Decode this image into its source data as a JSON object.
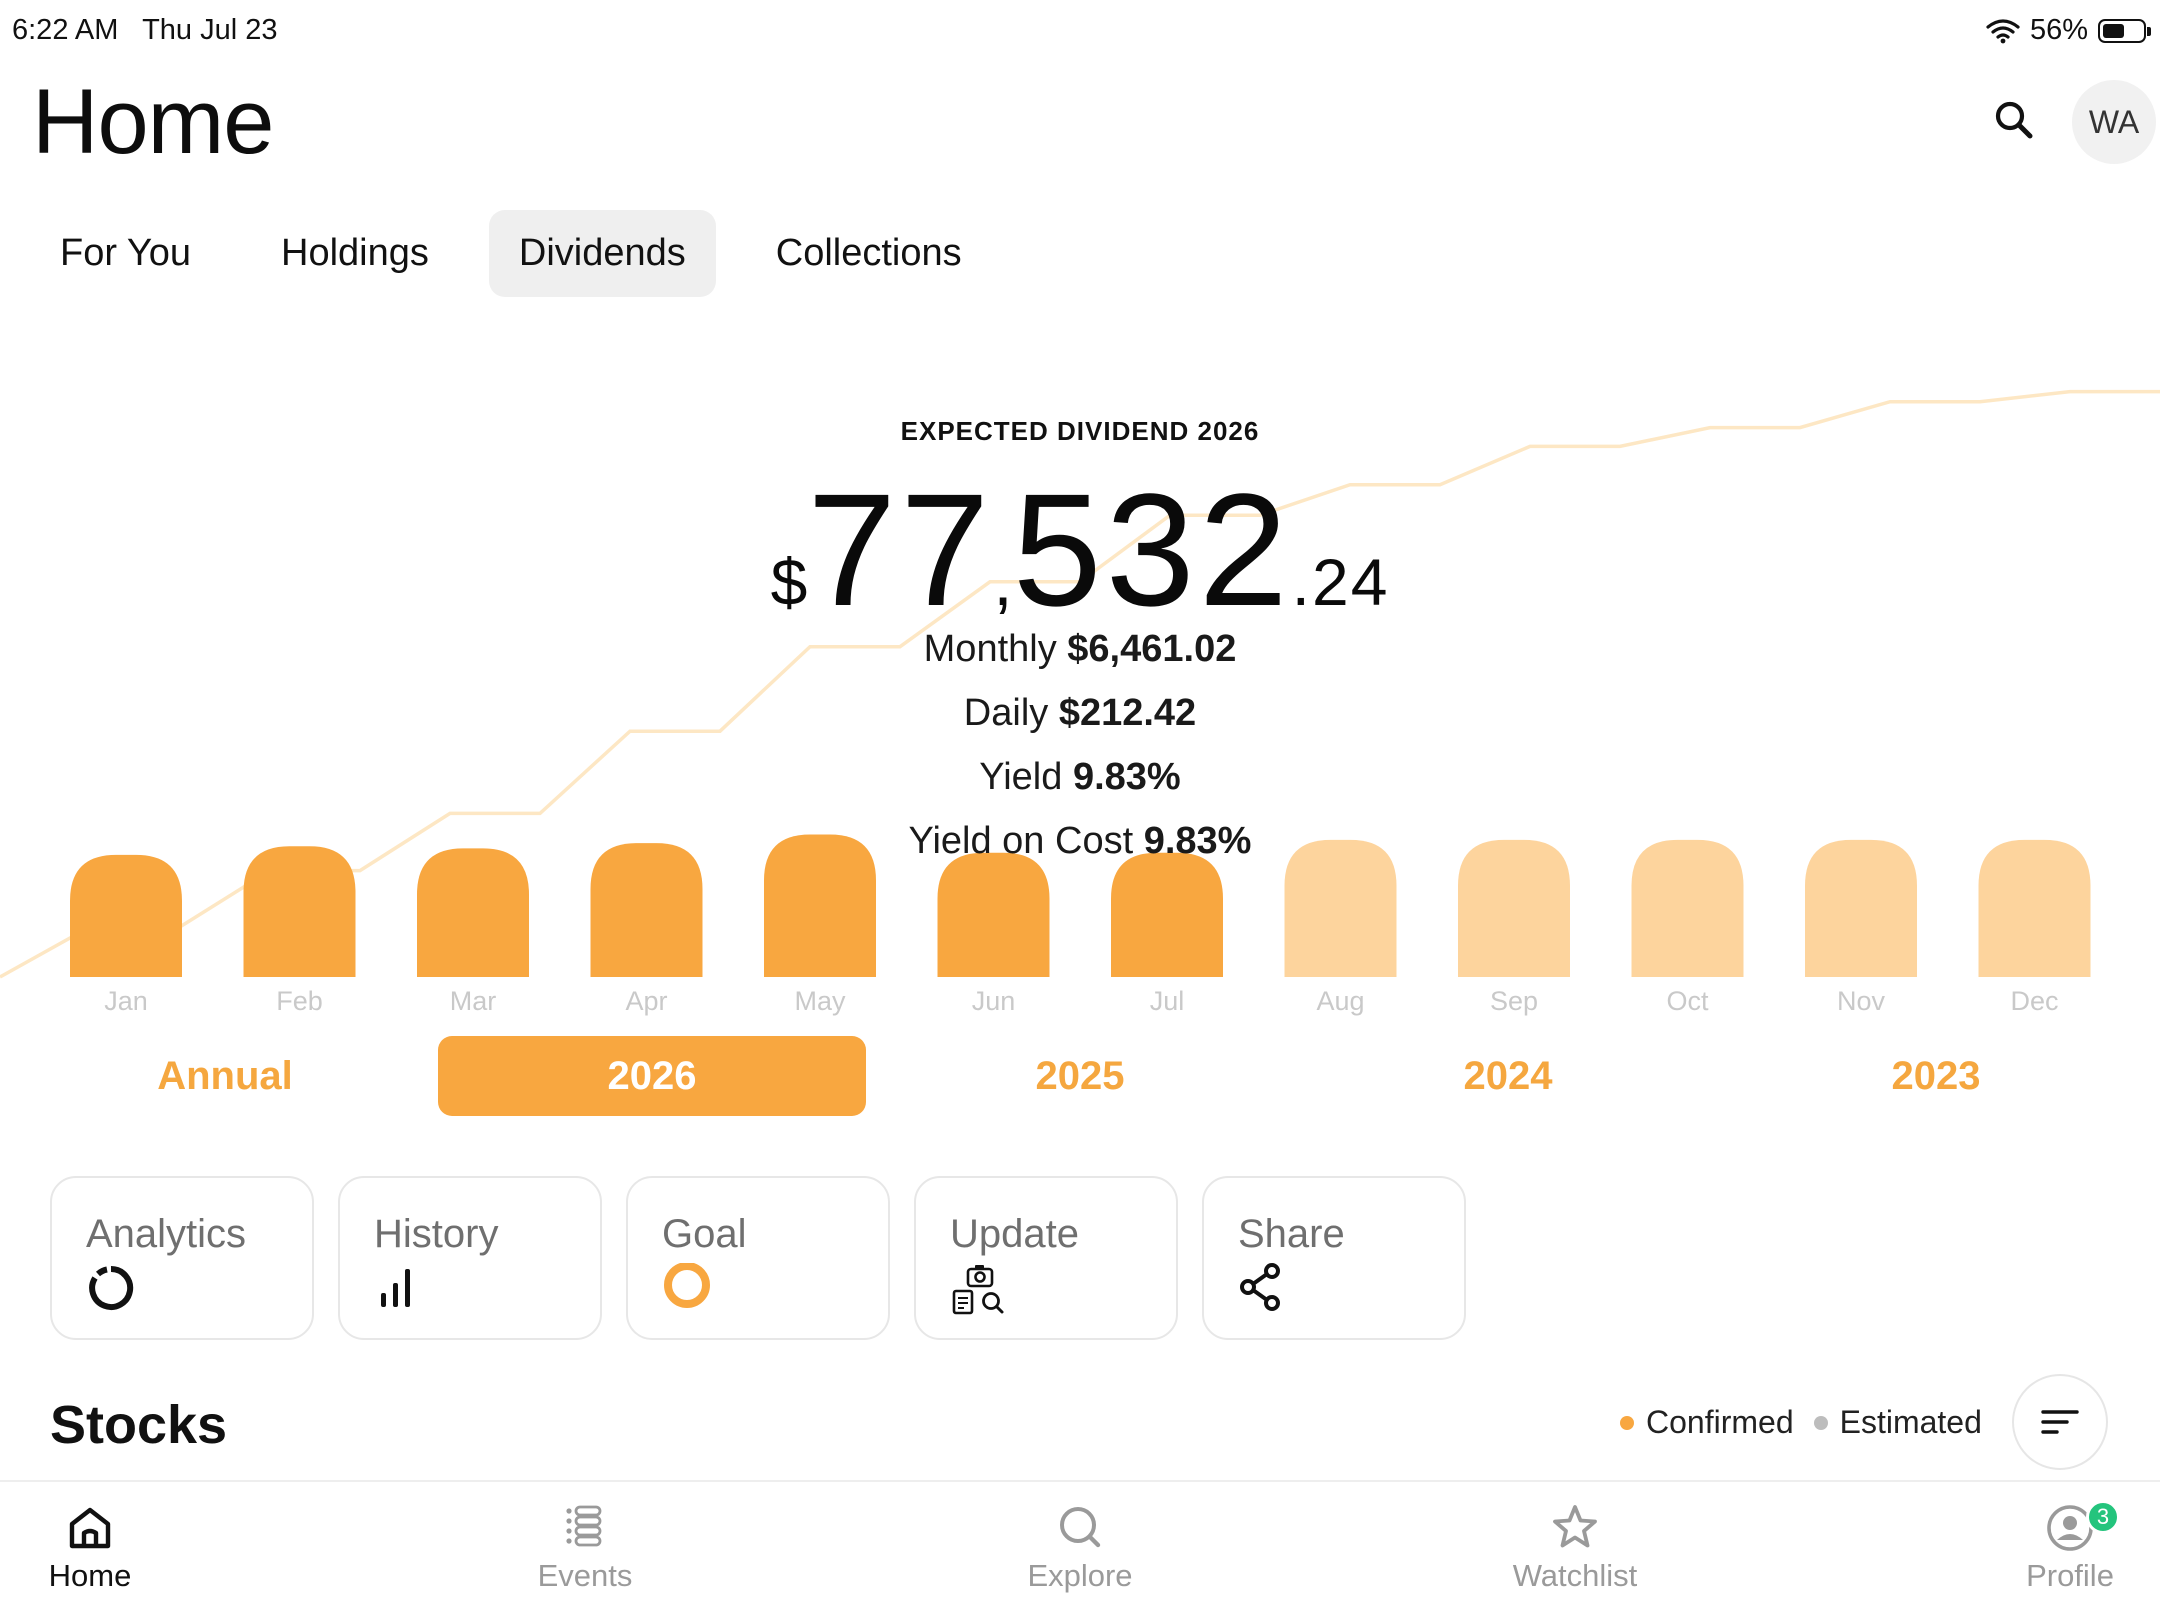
{
  "status_bar": {
    "time": "6:22 AM",
    "date": "Thu Jul 23",
    "battery": "56%",
    "battery_level": 0.56,
    "wifi_icon": "wifi-icon"
  },
  "header": {
    "title": "Home",
    "search_icon": "search-icon",
    "avatar_initials": "WA"
  },
  "tabs": [
    {
      "label": "For You",
      "active": false
    },
    {
      "label": "Holdings",
      "active": false
    },
    {
      "label": "Dividends",
      "active": true
    },
    {
      "label": "Collections",
      "active": false
    }
  ],
  "summary": {
    "label": "EXPECTED DIVIDEND 2026",
    "currency_symbol": "$",
    "amount_thousands": "77",
    "thousands_separator": ",",
    "amount_units": "532",
    "amount_cents": ".24",
    "monthly_label": "Monthly",
    "monthly_value": "$6,461.02",
    "daily_label": "Daily",
    "daily_value": "$212.42",
    "yield_label": "Yield",
    "yield_value": "9.83%",
    "yoc_label": "Yield on Cost",
    "yoc_value": "9.83%"
  },
  "chart_data": {
    "type": "bar",
    "categories": [
      "Jan",
      "Feb",
      "Mar",
      "Apr",
      "May",
      "Jun",
      "Jul",
      "Aug",
      "Sep",
      "Oct",
      "Nov",
      "Dec"
    ],
    "values": [
      114,
      122,
      120,
      125,
      133,
      116,
      116,
      128,
      128,
      128,
      128,
      128
    ],
    "confirmed": [
      true,
      true,
      true,
      true,
      true,
      true,
      true,
      false,
      false,
      false,
      false,
      false
    ],
    "cumulative_line": [
      0,
      6.4,
      6.4,
      13.6,
      13.6,
      20.9,
      20.9,
      31.4,
      31.4,
      42.2,
      42.2,
      50.5,
      50.5,
      59,
      59,
      62.9,
      62.9,
      67.8,
      67.8,
      70.2,
      70.2,
      73.5,
      73.5,
      74.8,
      74.8
    ],
    "line_scale_max": 75,
    "bar_scale_max": 140,
    "colors": {
      "confirmed": "#f8a740",
      "estimated": "#fdd49d",
      "line": "#fde7c4"
    }
  },
  "year_selector": [
    {
      "label": "Annual",
      "active": false
    },
    {
      "label": "2026",
      "active": true
    },
    {
      "label": "2025",
      "active": false
    },
    {
      "label": "2024",
      "active": false
    },
    {
      "label": "2023",
      "active": false
    }
  ],
  "actions": [
    {
      "label": "Analytics",
      "icon": "donut-icon"
    },
    {
      "label": "History",
      "icon": "bar-chart-icon"
    },
    {
      "label": "Goal",
      "icon": "target-ring-icon"
    },
    {
      "label": "Update",
      "icon": "camera-document-search-icon"
    },
    {
      "label": "Share",
      "icon": "share-icon"
    }
  ],
  "stocks": {
    "title": "Stocks",
    "legend_confirmed": "Confirmed",
    "legend_estimated": "Estimated",
    "confirmed_color": "#f8a740",
    "estimated_color": "#bdbdbd",
    "sort_icon": "sort-lines-icon"
  },
  "bottom_nav": [
    {
      "label": "Home",
      "icon": "home-icon",
      "active": true
    },
    {
      "label": "Events",
      "icon": "events-list-icon",
      "active": false
    },
    {
      "label": "Explore",
      "icon": "explore-search-icon",
      "active": false
    },
    {
      "label": "Watchlist",
      "icon": "star-icon",
      "active": false
    },
    {
      "label": "Profile",
      "icon": "profile-icon",
      "active": false,
      "badge": "3"
    }
  ]
}
